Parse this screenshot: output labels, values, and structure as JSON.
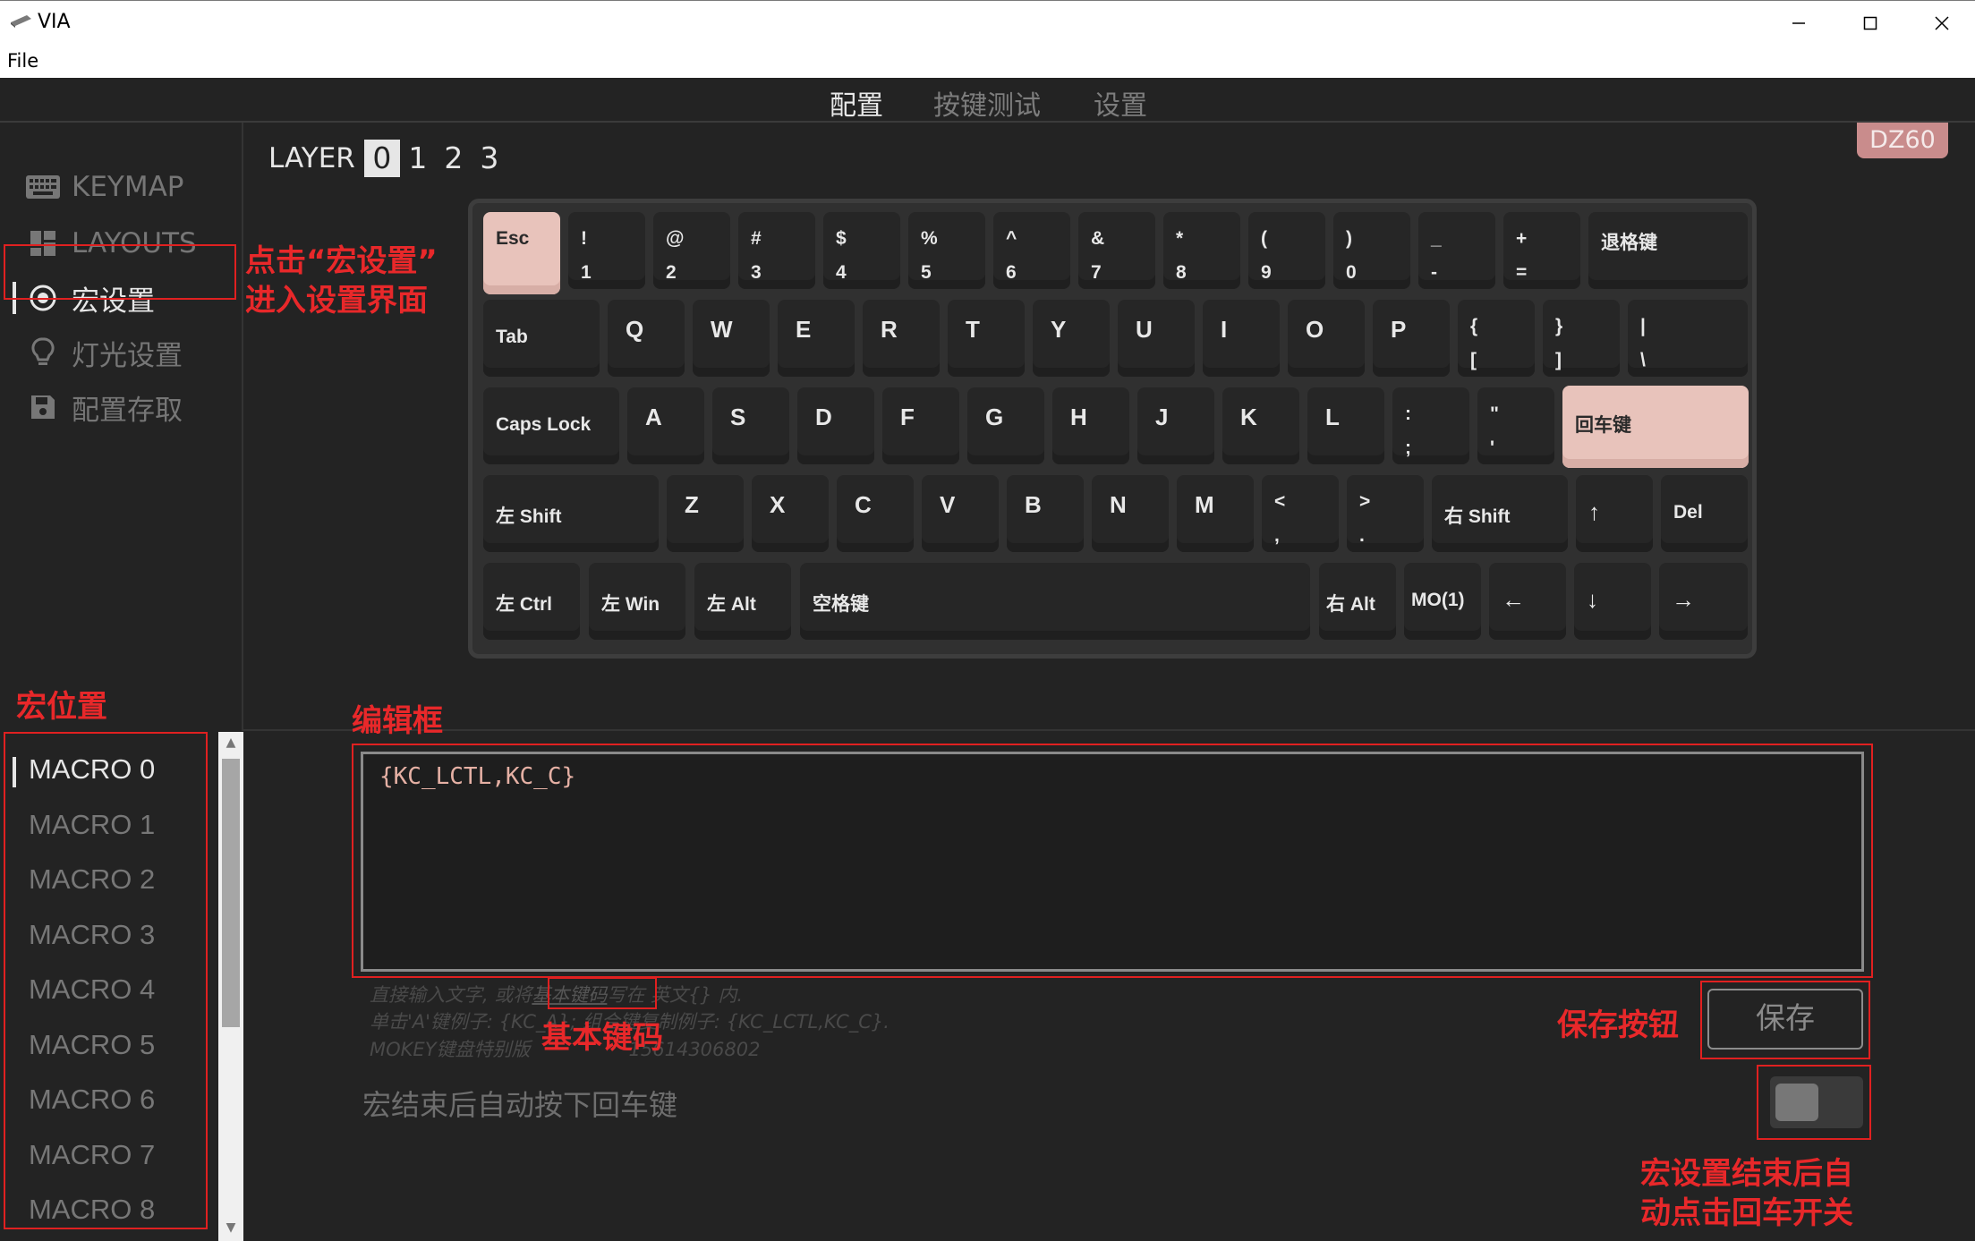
{
  "window": {
    "title": "VIA",
    "menu_file": "File"
  },
  "tabs": [
    {
      "label": "配置"
    },
    {
      "label": "按键测试"
    },
    {
      "label": "设置"
    }
  ],
  "sidebar": {
    "items": [
      {
        "label": "KEYMAP",
        "icon": "keyboard-icon"
      },
      {
        "label": "LAYOUTS",
        "icon": "layouts-icon"
      },
      {
        "label": "宏设置",
        "icon": "target-icon"
      },
      {
        "label": "灯光设置",
        "icon": "bulb-icon"
      },
      {
        "label": "配置存取",
        "icon": "floppy-icon"
      }
    ]
  },
  "layer": {
    "label": "LAYER",
    "numbers": [
      "0",
      "1",
      "2",
      "3"
    ],
    "selected": "0"
  },
  "device_badge": "DZ60",
  "keyboard": {
    "keys": [
      [
        "Esc",
        ""
      ],
      [
        "!",
        "1"
      ],
      [
        "@",
        "2"
      ],
      [
        "#",
        "3"
      ],
      [
        "$",
        "4"
      ],
      [
        "%",
        "5"
      ],
      [
        "^",
        "6"
      ],
      [
        "&",
        "7"
      ],
      [
        "*",
        "8"
      ],
      [
        "(",
        "9"
      ],
      [
        ")",
        "0"
      ],
      [
        "_",
        "-"
      ],
      [
        "+",
        "="
      ],
      [
        "退格键",
        ""
      ],
      [
        "Tab",
        ""
      ],
      [
        "Q",
        ""
      ],
      [
        "W",
        ""
      ],
      [
        "E",
        ""
      ],
      [
        "R",
        ""
      ],
      [
        "T",
        ""
      ],
      [
        "Y",
        ""
      ],
      [
        "U",
        ""
      ],
      [
        "I",
        ""
      ],
      [
        "O",
        ""
      ],
      [
        "P",
        ""
      ],
      [
        "{",
        "["
      ],
      [
        "}",
        "]"
      ],
      [
        "|",
        "\\"
      ],
      [
        "Caps Lock",
        ""
      ],
      [
        "A",
        ""
      ],
      [
        "S",
        ""
      ],
      [
        "D",
        ""
      ],
      [
        "F",
        ""
      ],
      [
        "G",
        ""
      ],
      [
        "H",
        ""
      ],
      [
        "J",
        ""
      ],
      [
        "K",
        ""
      ],
      [
        "L",
        ""
      ],
      [
        ":",
        ";"
      ],
      [
        "\"",
        "'"
      ],
      [
        "回车键",
        ""
      ],
      [
        "左 Shift",
        ""
      ],
      [
        "Z",
        ""
      ],
      [
        "X",
        ""
      ],
      [
        "C",
        ""
      ],
      [
        "V",
        ""
      ],
      [
        "B",
        ""
      ],
      [
        "N",
        ""
      ],
      [
        "M",
        ""
      ],
      [
        "<",
        ","
      ],
      [
        ">",
        "."
      ],
      [
        "右 Shift",
        ""
      ],
      [
        "↑",
        ""
      ],
      [
        "Del",
        ""
      ],
      [
        "左 Ctrl",
        ""
      ],
      [
        "左 Win",
        ""
      ],
      [
        "左 Alt",
        ""
      ],
      [
        "空格键",
        ""
      ],
      [
        "右 Alt",
        ""
      ],
      [
        "MO(1)",
        ""
      ],
      [
        "←",
        ""
      ],
      [
        "↓",
        ""
      ],
      [
        "→",
        ""
      ]
    ]
  },
  "macros": {
    "items": [
      "MACRO 0",
      "MACRO 1",
      "MACRO 2",
      "MACRO 3",
      "MACRO 4",
      "MACRO 5",
      "MACRO 6",
      "MACRO 7",
      "MACRO 8"
    ],
    "selected": "MACRO 0"
  },
  "editor": {
    "value": "{KC_LCTL,KC_C}",
    "hint_line1_a": "直接输入文字, 或将",
    "hint_link": "基本键码",
    "hint_line1_b": "写在 英文{} 内.",
    "hint_line2": "单击'A'键例子: {KC_A}; 组合键复制例子: {KC_LCTL,KC_C}.",
    "hint_line3_a": "MOKEY键盘特别版",
    "hint_line3_b": "15614306802"
  },
  "save_button": "保存",
  "auto_enter_label": "宏结束后自动按下回车键",
  "annotations": {
    "macro_settings": "点击“宏设置”\n进入设置界面",
    "macro_position": "宏位置",
    "editor_box": "编辑框",
    "basic_keycode": "基本键码",
    "save_button": "保存按钮",
    "auto_enter": "宏设置结束后自\n动点击回车开关"
  },
  "colors": {
    "accent_key": "#e8c3bb",
    "annotation_red": "#e02020",
    "badge": "#c98c8c"
  }
}
